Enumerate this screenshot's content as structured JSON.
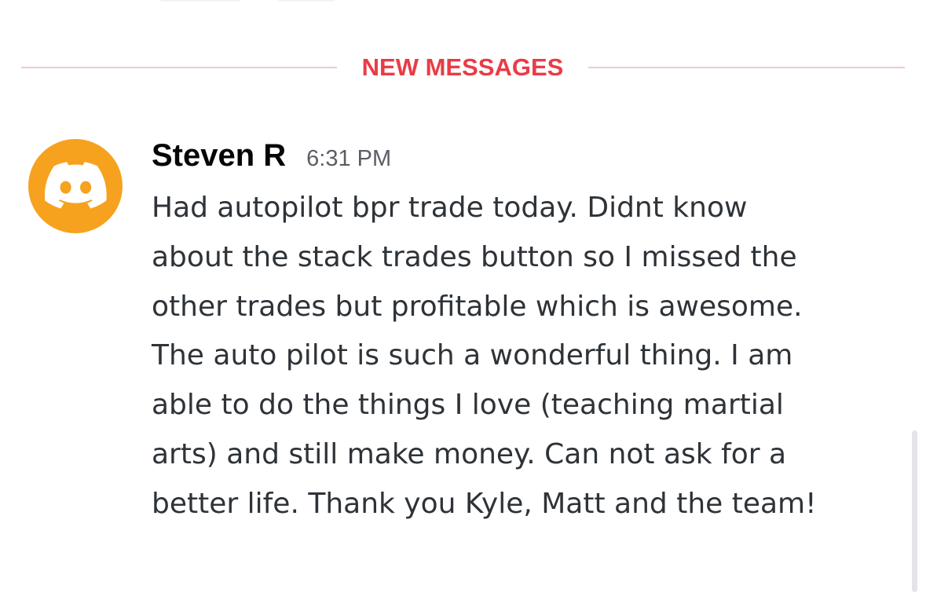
{
  "divider": {
    "label": "NEW MESSAGES",
    "color": "#e93c46"
  },
  "message": {
    "author": "Steven R",
    "timestamp": "6:31 PM",
    "avatar": {
      "icon": "discord-logo-icon",
      "background": "#f6a21f"
    },
    "content": "Had autopilot bpr trade today. Didnt know\nabout the stack trades button so I missed the\nother trades but profitable which is awesome.\nThe auto pilot is such a wonderful thing. I am\nable to do the things I love (teaching martial\narts) and still make money. Can not ask for a\nbetter life. Thank you Kyle, Matt and the team!"
  }
}
